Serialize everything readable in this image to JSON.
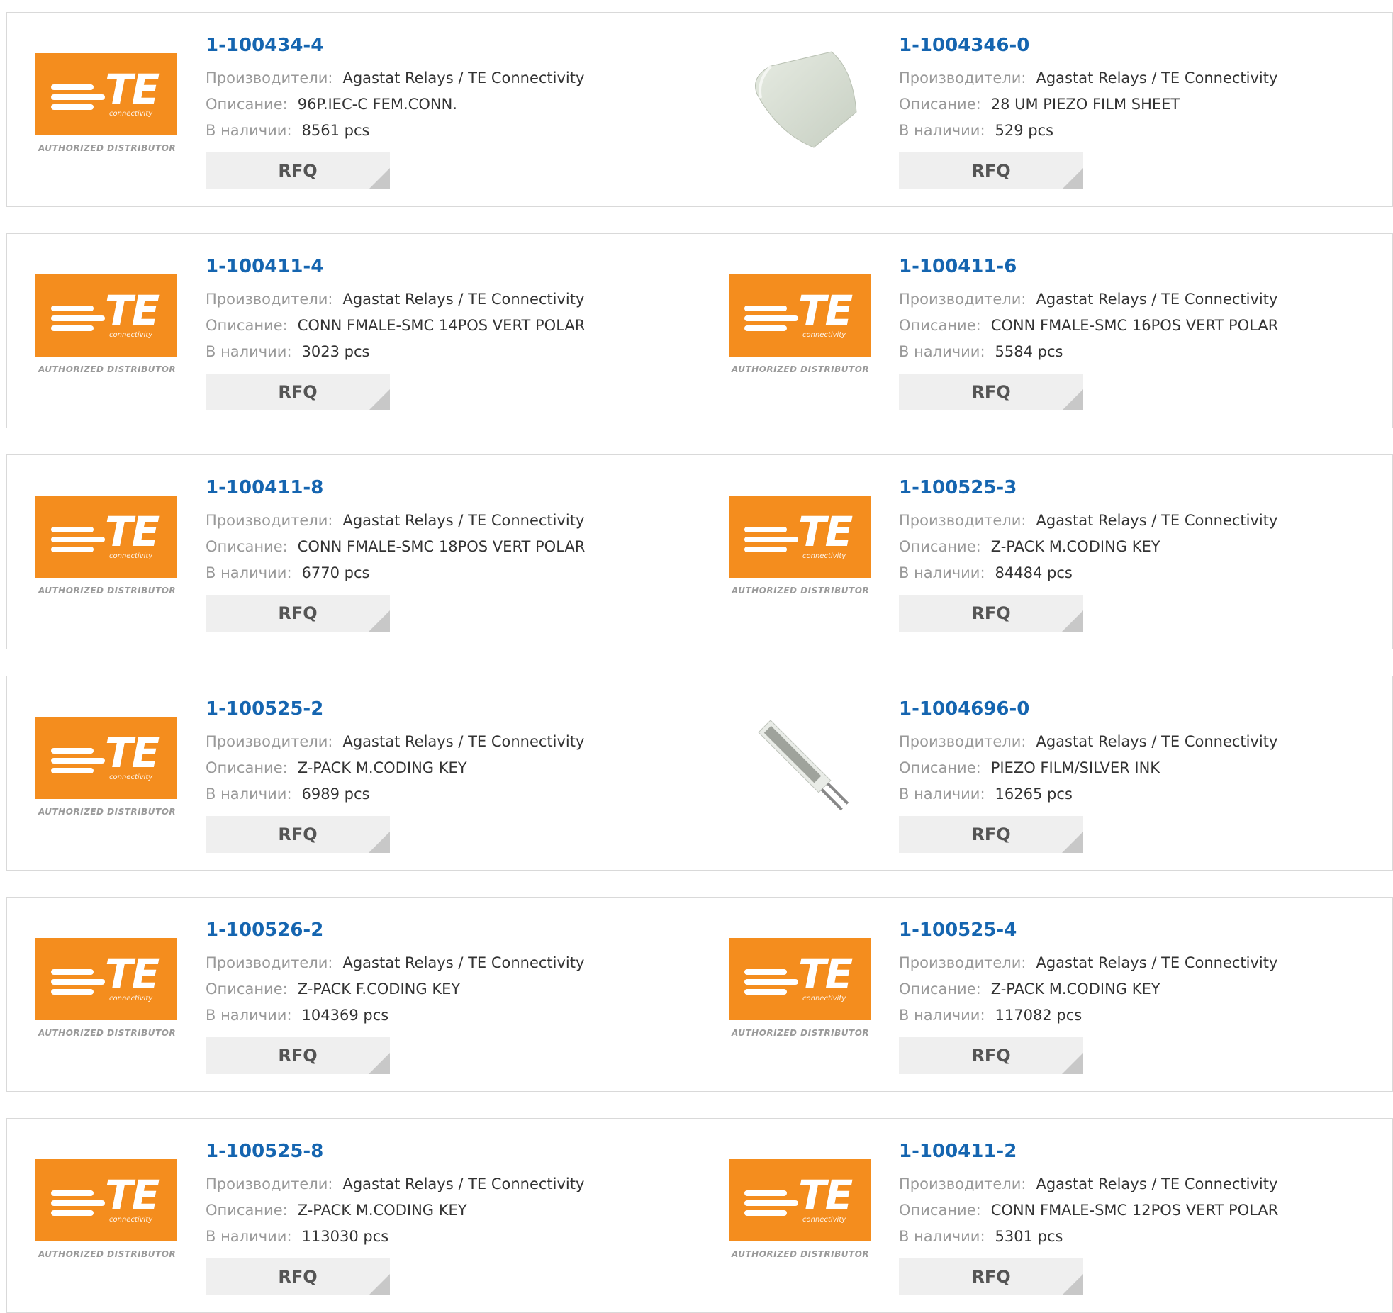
{
  "labels": {
    "manufacturer": "Производители:",
    "description": "Описание:",
    "stock": "В наличии:",
    "rfq": "RFQ"
  },
  "logo": {
    "brand": "TE",
    "subtitle": "connectivity",
    "tagline": "AUTHORIZED DISTRIBUTOR",
    "color": "#f48d1e"
  },
  "colors": {
    "part_link": "#1565b0",
    "label": "#999999",
    "value": "#333333"
  },
  "products": [
    {
      "part": "1-100434-4",
      "manufacturer": "Agastat Relays / TE Connectivity",
      "description": "96P.IEC-C FEM.CONN.",
      "stock": "8561 pcs",
      "image": "te-logo"
    },
    {
      "part": "1-1004346-0",
      "manufacturer": "Agastat Relays / TE Connectivity",
      "description": "28 UM PIEZO FILM SHEET",
      "stock": "529 pcs",
      "image": "piezo-film-sheet-photo"
    },
    {
      "part": "1-100411-4",
      "manufacturer": "Agastat Relays / TE Connectivity",
      "description": "CONN FMALE-SMC 14POS VERT POLAR",
      "stock": "3023 pcs",
      "image": "te-logo"
    },
    {
      "part": "1-100411-6",
      "manufacturer": "Agastat Relays / TE Connectivity",
      "description": "CONN FMALE-SMC 16POS VERT POLAR",
      "stock": "5584 pcs",
      "image": "te-logo"
    },
    {
      "part": "1-100411-8",
      "manufacturer": "Agastat Relays / TE Connectivity",
      "description": "CONN FMALE-SMC 18POS VERT POLAR",
      "stock": "6770 pcs",
      "image": "te-logo"
    },
    {
      "part": "1-100525-3",
      "manufacturer": "Agastat Relays / TE Connectivity",
      "description": "Z-PACK M.CODING KEY",
      "stock": "84484 pcs",
      "image": "te-logo"
    },
    {
      "part": "1-100525-2",
      "manufacturer": "Agastat Relays / TE Connectivity",
      "description": "Z-PACK M.CODING KEY",
      "stock": "6989 pcs",
      "image": "te-logo"
    },
    {
      "part": "1-1004696-0",
      "manufacturer": "Agastat Relays / TE Connectivity",
      "description": "PIEZO FILM/SILVER INK",
      "stock": "16265 pcs",
      "image": "piezo-strip-photo"
    },
    {
      "part": "1-100526-2",
      "manufacturer": "Agastat Relays / TE Connectivity",
      "description": "Z-PACK F.CODING KEY",
      "stock": "104369 pcs",
      "image": "te-logo"
    },
    {
      "part": "1-100525-4",
      "manufacturer": "Agastat Relays / TE Connectivity",
      "description": "Z-PACK M.CODING KEY",
      "stock": "117082 pcs",
      "image": "te-logo"
    },
    {
      "part": "1-100525-8",
      "manufacturer": "Agastat Relays / TE Connectivity",
      "description": "Z-PACK M.CODING KEY",
      "stock": "113030 pcs",
      "image": "te-logo"
    },
    {
      "part": "1-100411-2",
      "manufacturer": "Agastat Relays / TE Connectivity",
      "description": "CONN FMALE-SMC 12POS VERT POLAR",
      "stock": "5301 pcs",
      "image": "te-logo"
    }
  ]
}
